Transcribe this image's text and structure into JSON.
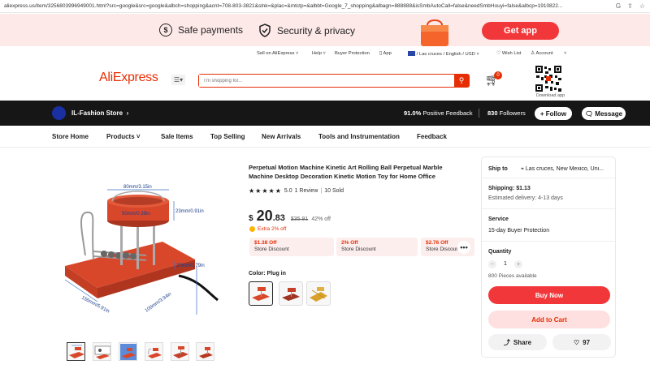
{
  "browser": {
    "url": "aliexpress.us/item/3256803996949001.html?src=google&src=google&albch=shopping&acnt=708-803-3821&slnk=&plac=&mtctp=&albbt=Google_7_shopping&albagn=888888&isSmbAutoCall=false&needSmbHouyi=false&albcp=1910822..."
  },
  "banner": {
    "safe_payments": "Safe payments",
    "security_privacy": "Security & privacy",
    "get_app": "Get app"
  },
  "toplinks": {
    "sell": "Sell on AliExpress",
    "help": "Help",
    "buyer_protection": "Buyer Protection",
    "app": "App",
    "locale": "/ Las cruces / English / USD",
    "wishlist": "Wish List",
    "account": "Account"
  },
  "header": {
    "logo": "AliExpress",
    "search_placeholder": "I'm shopping for...",
    "cart_count": "0",
    "download_app": "Download app"
  },
  "store": {
    "name": "IL-Fashion Store",
    "feedback_value": "91.0%",
    "feedback_label": "Positive Feedback",
    "followers_value": "830",
    "followers_label": "Followers",
    "follow": "Follow",
    "message": "Message"
  },
  "nav": {
    "items": [
      "Store Home",
      "Products",
      "Sale Items",
      "Top Selling",
      "New Arrivals",
      "Tools and Instrumentation",
      "Feedback"
    ]
  },
  "product": {
    "title": "Perpetual Motion Machine Kinetic Art Rolling Ball Perpetual Marble Machine Desktop Decoration Kinetic Motion Toy for Home Office",
    "rating": "5.0",
    "reviews": "1 Review",
    "sold": "10 Sold",
    "price_currency": "$",
    "price_whole": "20",
    "price_cents": ".83",
    "price_old": "$35.91",
    "discount": "42% off",
    "extra": "Extra 2% off",
    "coupons": [
      {
        "amount": "$1.38 Off",
        "label": "Store Discount"
      },
      {
        "amount": "2% Off",
        "label": "Store Discount"
      },
      {
        "amount": "$2.76 Off",
        "label": "Store Discount"
      }
    ],
    "color_label": "Color: Plug in",
    "dimensions": {
      "top": "80mm/3.15in",
      "inner": "50mm/0.39in",
      "right": "23mm/0.91in",
      "base_h": "20mm/0.79in",
      "length": "150mm/5.91in",
      "depth": "100mm/3.94in"
    }
  },
  "side": {
    "ship_to": "Ship to",
    "location": "Las cruces, New Mexico, Uni...",
    "shipping": "Shipping: $1.13",
    "delivery": "Estimated delivery: 4-13 days",
    "service": "Service",
    "service_value": "15-day Buyer Protection",
    "quantity": "Quantity",
    "qty_value": "1",
    "available": "800 Pieces available",
    "buy_now": "Buy Now",
    "add_to_cart": "Add to Cart",
    "share": "Share",
    "likes": "97"
  }
}
